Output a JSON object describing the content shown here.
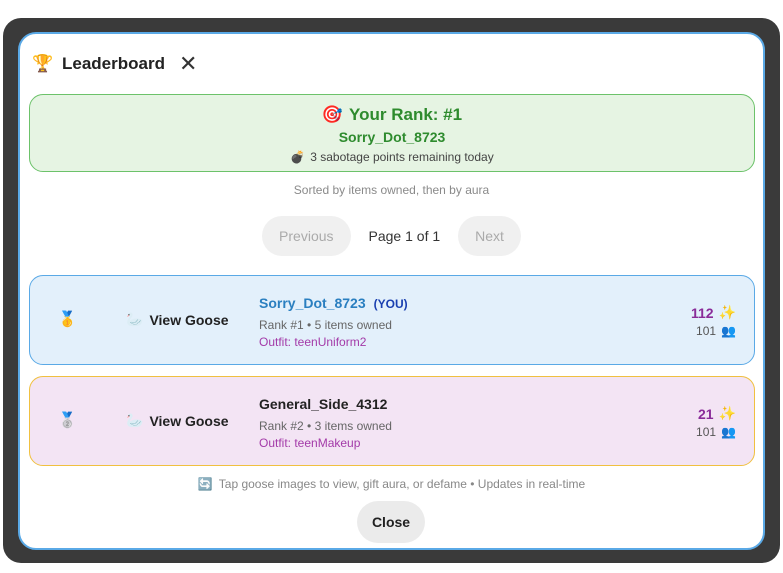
{
  "header": {
    "title": "Leaderboard",
    "trophy_icon": "🏆",
    "close_icon": "✕"
  },
  "rank_card": {
    "target_icon": "🎯",
    "rank_text": "Your Rank: #1",
    "username": "Sorry_Dot_8723",
    "bomb_icon": "💣",
    "sabotage_text": "3 sabotage points remaining today"
  },
  "sort_note": "Sorted by items owned, then by aura",
  "pagination": {
    "previous": "Previous",
    "page_info": "Page 1 of 1",
    "next": "Next"
  },
  "entries": [
    {
      "medal": "🥇",
      "goose_icon": "🦢",
      "view_label": "View Goose",
      "username": "Sorry_Dot_8723",
      "you_tag": "(YOU)",
      "rank_info": "Rank #1 • 5 items owned",
      "outfit": "Outfit: teenUniform2",
      "aura": "112",
      "aura_icon": "✨",
      "followers": "101",
      "followers_icon": "👥"
    },
    {
      "medal": "🥈",
      "goose_icon": "🦢",
      "view_label": "View Goose",
      "username": "General_Side_4312",
      "rank_info": "Rank #2 • 3 items owned",
      "outfit": "Outfit: teenMakeup",
      "aura": "21",
      "aura_icon": "✨",
      "followers": "101",
      "followers_icon": "👥"
    }
  ],
  "footer": {
    "refresh_icon": "🔄",
    "note": "Tap goose images to view, gift aura, or defame • Updates in real-time",
    "close_label": "Close"
  }
}
